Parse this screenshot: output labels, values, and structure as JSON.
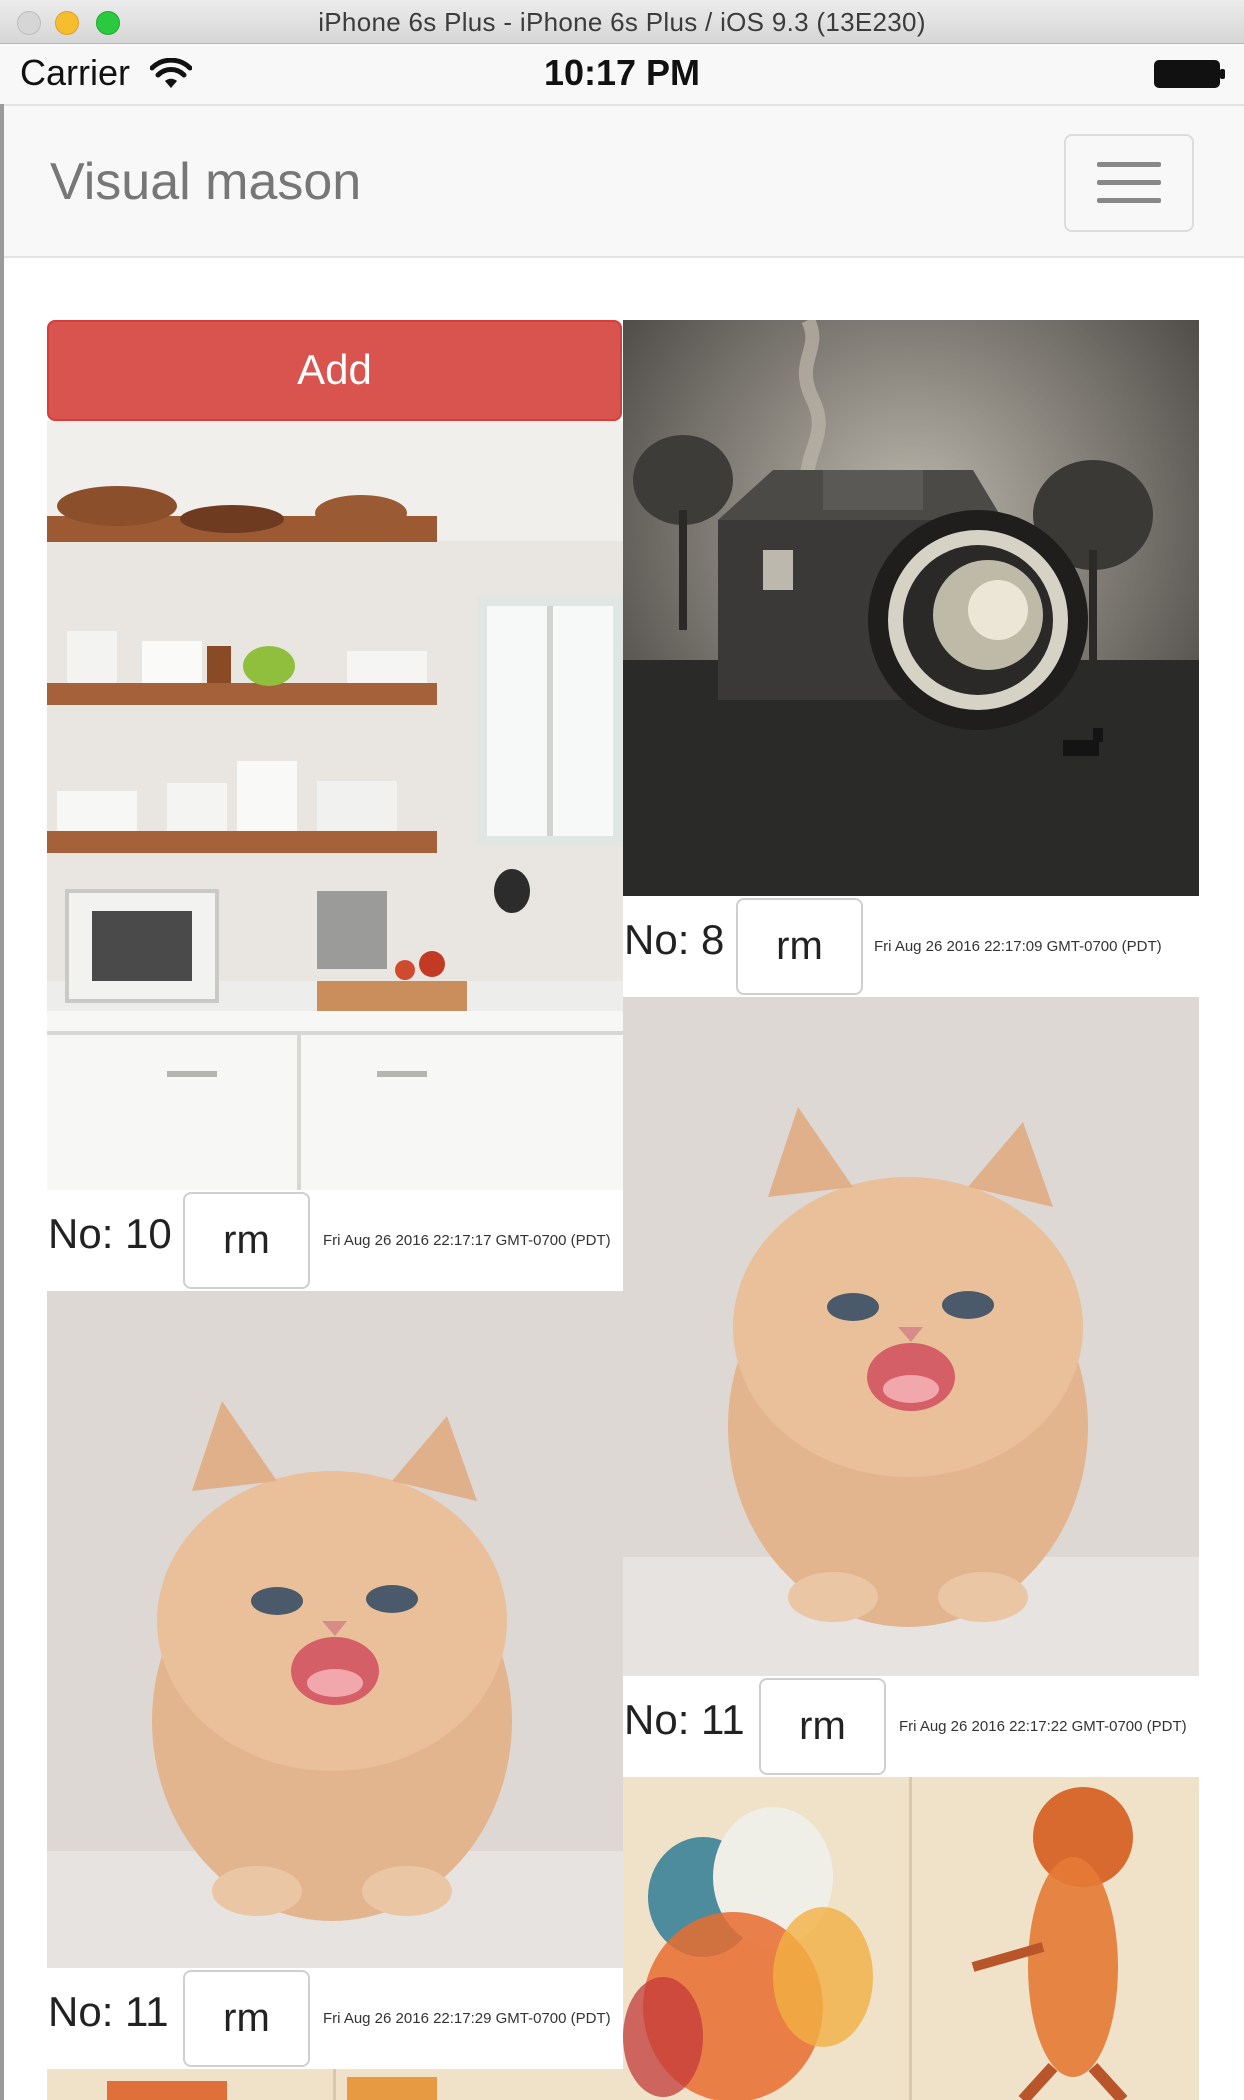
{
  "window": {
    "title": "iPhone 6s Plus - iPhone 6s Plus / iOS 9.3 (13E230)"
  },
  "statusbar": {
    "carrier": "Carrier",
    "time": "10:17 PM",
    "icons": [
      "wifi-icon",
      "battery-icon"
    ]
  },
  "navbar": {
    "brand": "Visual mason",
    "toggle_icon": "hamburger-menu-icon"
  },
  "actions": {
    "add_label": "Add"
  },
  "colors": {
    "add_button": "#d9534f",
    "navbar_bg": "#f8f8f8",
    "brand_text": "#777777"
  },
  "cards": [
    {
      "column": "left",
      "image": "kitchen-shelves-photo",
      "no_label": "No: 10",
      "rm_label": "rm",
      "timestamp": "Fri Aug 26 2016 22:17:17 GMT-0700 (PDT)"
    },
    {
      "column": "left",
      "image": "kitten-photo",
      "no_label": "No: 11",
      "rm_label": "rm",
      "timestamp": "Fri Aug 26 2016 22:17:29 GMT-0700 (PDT)"
    },
    {
      "column": "right",
      "image": "camera-house-photo",
      "no_label": "No: 8",
      "rm_label": "rm",
      "timestamp": "Fri Aug 26 2016 22:17:09 GMT-0700 (PDT)"
    },
    {
      "column": "right",
      "image": "kitten-photo",
      "no_label": "No: 11",
      "rm_label": "rm",
      "timestamp": "Fri Aug 26 2016 22:17:22 GMT-0700 (PDT)"
    },
    {
      "column": "right",
      "image": "lions-watercolor-photo",
      "no_label": "",
      "rm_label": "",
      "timestamp": ""
    }
  ]
}
